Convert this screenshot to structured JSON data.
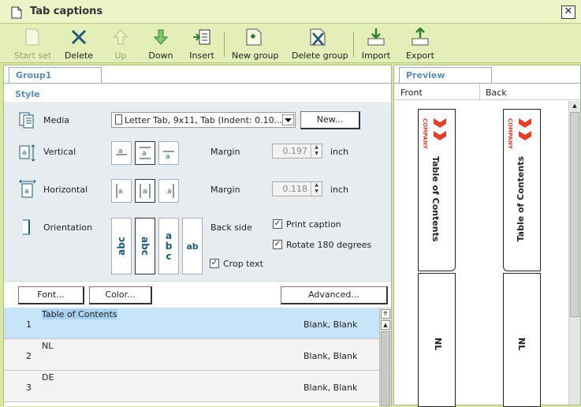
{
  "window": {
    "title": "Tab captions",
    "close": "✕"
  },
  "toolbar": {
    "start_set": "Start set",
    "delete": "Delete",
    "up": "Up",
    "down": "Down",
    "insert": "Insert",
    "new_group": "New group",
    "delete_group": "Delete group",
    "import": "Import",
    "export": "Export"
  },
  "left": {
    "tab": "Group1",
    "section": "Style",
    "media_label": "Media",
    "media_value": "Letter Tab, 9x11, Tab (Indent: 0.10...",
    "new_button": "New...",
    "vertical_label": "Vertical",
    "horizontal_label": "Horizontal",
    "orientation_label": "Orientation",
    "margin_label": "Margin",
    "vertical_margin": "0.197",
    "horizontal_margin": "0.118",
    "unit": "inch",
    "back_side": "Back side",
    "print_caption": "Print caption",
    "rotate": "Rotate 180 degrees",
    "crop_text": "Crop text",
    "font_button": "Font...",
    "color_button": "Color...",
    "advanced_button": "Advanced...",
    "orient_glyphs": [
      "abc",
      "abc",
      "abc",
      "ab"
    ],
    "align_glyph": "a"
  },
  "list": {
    "rows": [
      {
        "num": "1",
        "name": "Table of Contents",
        "sides": "Blank, Blank"
      },
      {
        "num": "2",
        "name": "NL",
        "sides": "Blank, Blank"
      },
      {
        "num": "3",
        "name": "DE",
        "sides": "Blank, Blank"
      }
    ]
  },
  "preview": {
    "tab": "Preview",
    "front": "Front",
    "back": "Back",
    "tab1_text": "Table of Contents",
    "tab2_text": "NL",
    "logo_text": "COMPANY"
  },
  "colors": {
    "accent": "#5b8db8",
    "logo": "#e0402a",
    "toolbar_icon": "#2e7d32"
  }
}
